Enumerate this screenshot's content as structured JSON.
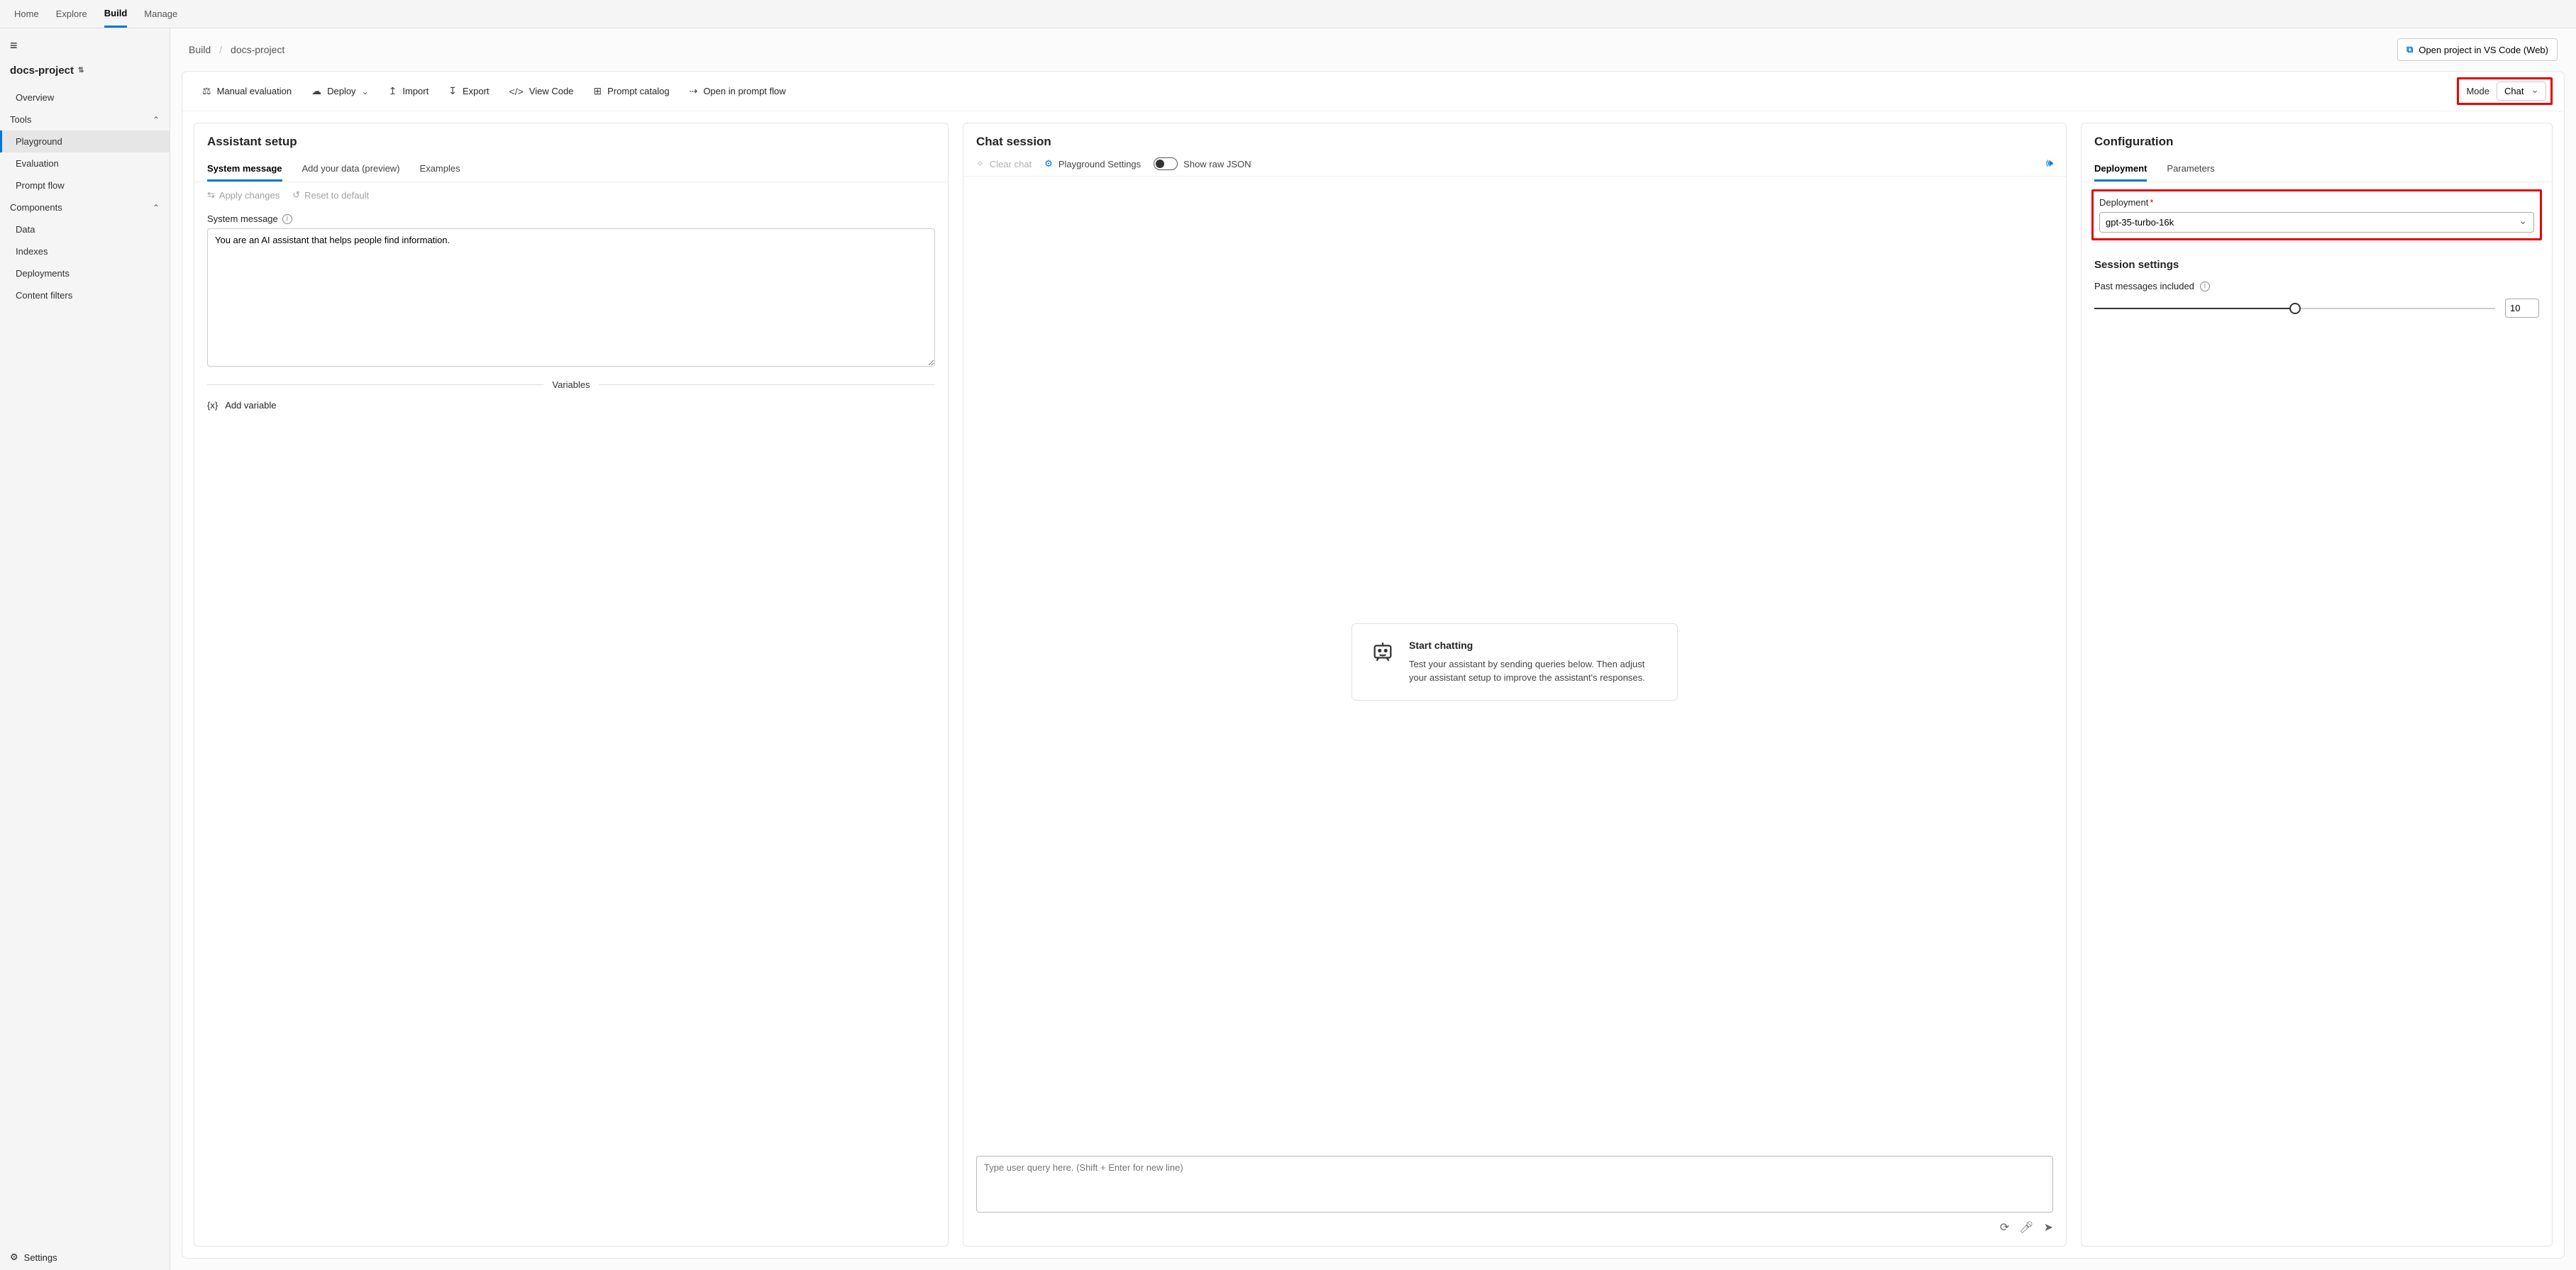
{
  "topnav": {
    "items": [
      "Home",
      "Explore",
      "Build",
      "Manage"
    ],
    "active": "Build"
  },
  "sidebar": {
    "project": "docs-project",
    "overview": "Overview",
    "tools_label": "Tools",
    "tools": [
      "Playground",
      "Evaluation",
      "Prompt flow"
    ],
    "components_label": "Components",
    "components": [
      "Data",
      "Indexes",
      "Deployments",
      "Content filters"
    ],
    "settings": "Settings"
  },
  "breadcrumb": {
    "root": "Build",
    "current": "docs-project"
  },
  "vscode_btn": "Open project in VS Code (Web)",
  "toolbar": {
    "manual_eval": "Manual evaluation",
    "deploy": "Deploy",
    "import": "Import",
    "export": "Export",
    "view_code": "View Code",
    "prompt_catalog": "Prompt catalog",
    "open_flow": "Open in prompt flow",
    "mode_label": "Mode",
    "mode_value": "Chat"
  },
  "assistant": {
    "title": "Assistant setup",
    "tabs": [
      "System message",
      "Add your data (preview)",
      "Examples"
    ],
    "apply": "Apply changes",
    "reset": "Reset to default",
    "sysmsg_label": "System message",
    "sysmsg_value": "You are an AI assistant that helps people find information.",
    "variables": "Variables",
    "add_variable": "Add variable"
  },
  "chat": {
    "title": "Chat session",
    "clear": "Clear chat",
    "settings": "Playground Settings",
    "raw_json": "Show raw JSON",
    "start_title": "Start chatting",
    "start_body": "Test your assistant by sending queries below. Then adjust your assistant setup to improve the assistant's responses.",
    "placeholder": "Type user query here. (Shift + Enter for new line)"
  },
  "config": {
    "title": "Configuration",
    "tabs": [
      "Deployment",
      "Parameters"
    ],
    "deploy_label": "Deployment",
    "deploy_value": "gpt-35-turbo-16k",
    "session_title": "Session settings",
    "past_label": "Past messages included",
    "past_value": "10"
  }
}
